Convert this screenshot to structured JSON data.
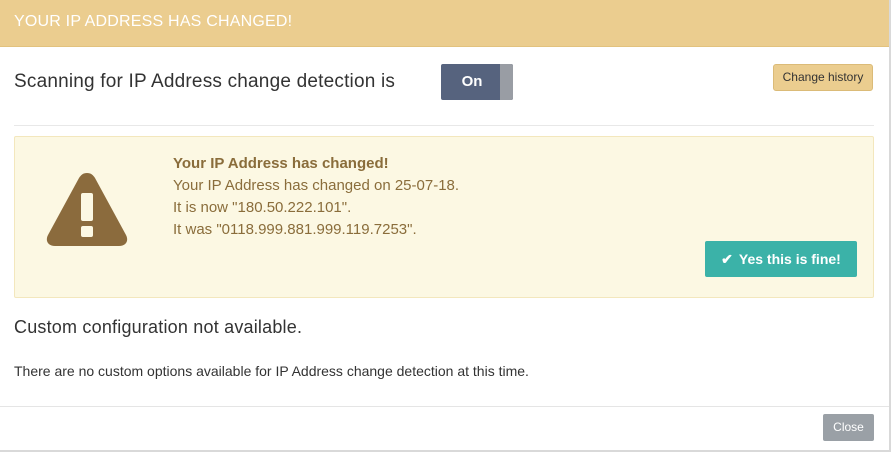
{
  "header": {
    "title": "YOUR IP ADDRESS HAS CHANGED!"
  },
  "scan": {
    "label": "Scanning for IP Address change detection is",
    "toggle_label": "On",
    "history_button": "Change history"
  },
  "alert": {
    "title": "Your IP Address has changed!",
    "line1": "Your IP Address has changed on 25-07-18.",
    "line2": "It is now \"180.50.222.101\".",
    "line3": "It was \"0118.999.881.999.119.7253\".",
    "confirm_button": "Yes this is fine!",
    "confirm_icon": "✔",
    "icon_name": "warning-icon",
    "colors": {
      "background": "#fcf8e3",
      "text": "#8a6d3b",
      "icon": "#8b6b3d",
      "button": "#3bb2a8"
    }
  },
  "custom": {
    "heading": "Custom configuration not available.",
    "text": "There are no custom options available for IP Address change detection at this time."
  },
  "footer": {
    "close_button": "Close"
  },
  "colors": {
    "header": "#ebcd8f",
    "toggle": "#56637e"
  }
}
